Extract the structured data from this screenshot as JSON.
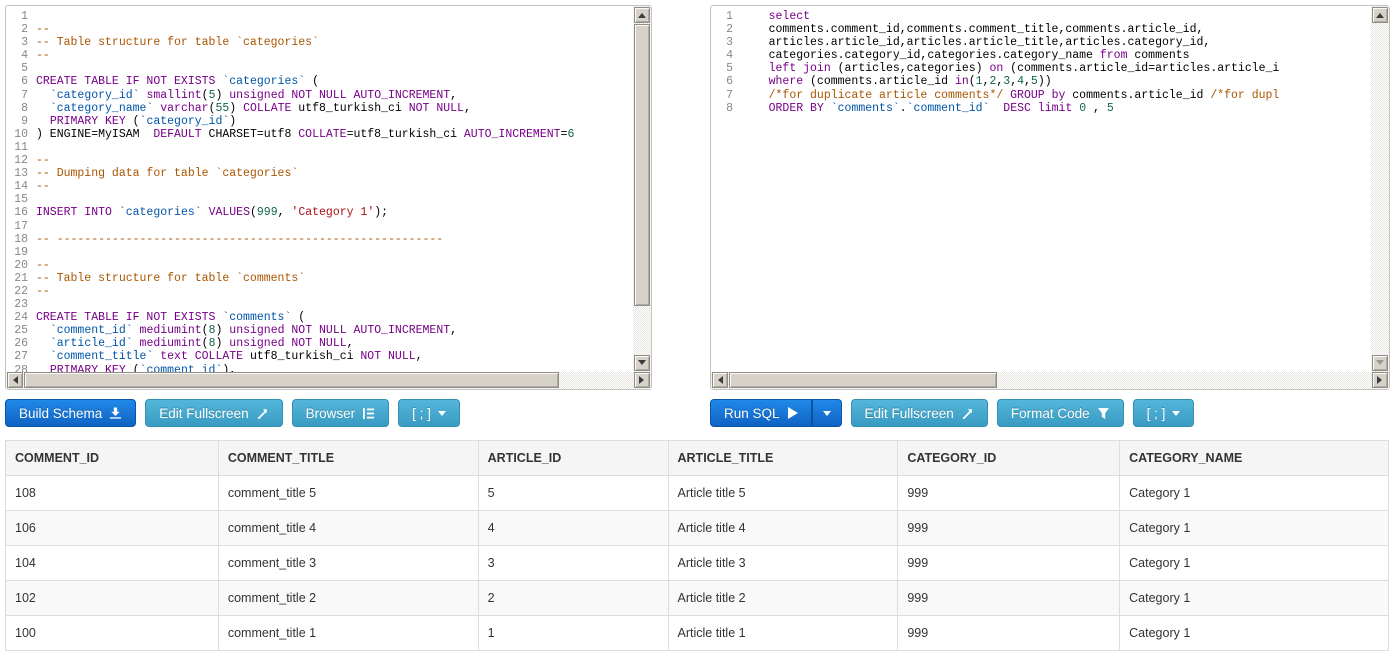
{
  "colors": {
    "keyword": "#770088",
    "comment": "#aa5500",
    "string": "#aa1111",
    "number": "#116644",
    "identifier": "#0055aa",
    "primary_button": "#0f63c3",
    "info_button": "#3a9bc2"
  },
  "icons": {
    "build_schema": "download-icon",
    "run_sql": "play-icon",
    "edit_fullscreen": "resize-full-icon",
    "browser": "indent-list-icon",
    "format_code": "funnel-icon",
    "terminator": "caret-down-icon"
  },
  "schema_panel": {
    "buttons": {
      "build_schema": "Build Schema",
      "edit_fullscreen": "Edit Fullscreen",
      "browser": "Browser",
      "terminator": "[ ; ]"
    },
    "lines": [
      [],
      [
        [
          "cm",
          "--"
        ]
      ],
      [
        [
          "cm",
          "-- Table structure for table `categories`"
        ]
      ],
      [
        [
          "cm",
          "--"
        ]
      ],
      [],
      [
        [
          "kw",
          "CREATE TABLE IF NOT EXISTS"
        ],
        [
          "p",
          " "
        ],
        [
          "id",
          "`categories`"
        ],
        [
          "p",
          " ("
        ]
      ],
      [
        [
          "p",
          "  "
        ],
        [
          "id",
          "`category_id`"
        ],
        [
          "p",
          " "
        ],
        [
          "kw",
          "smallint"
        ],
        [
          "p",
          "("
        ],
        [
          "num",
          "5"
        ],
        [
          "p",
          ") "
        ],
        [
          "kw",
          "unsigned NOT NULL AUTO_INCREMENT"
        ],
        [
          "p",
          ","
        ]
      ],
      [
        [
          "p",
          "  "
        ],
        [
          "id",
          "`category_name`"
        ],
        [
          "p",
          " "
        ],
        [
          "kw",
          "varchar"
        ],
        [
          "p",
          "("
        ],
        [
          "num",
          "55"
        ],
        [
          "p",
          ") "
        ],
        [
          "kw",
          "COLLATE"
        ],
        [
          "p",
          " utf8_turkish_ci "
        ],
        [
          "kw",
          "NOT NULL"
        ],
        [
          "p",
          ","
        ]
      ],
      [
        [
          "p",
          "  "
        ],
        [
          "kw",
          "PRIMARY KEY"
        ],
        [
          "p",
          " ("
        ],
        [
          "id",
          "`category_id`"
        ],
        [
          "p",
          ")"
        ]
      ],
      [
        [
          "p",
          ") ENGINE=MyISAM  "
        ],
        [
          "kw",
          "DEFAULT"
        ],
        [
          "p",
          " CHARSET=utf8 "
        ],
        [
          "kw",
          "COLLATE"
        ],
        [
          "p",
          "=utf8_turkish_ci "
        ],
        [
          "kw",
          "AUTO_INCREMENT"
        ],
        [
          "p",
          "="
        ],
        [
          "num",
          "6"
        ]
      ],
      [],
      [
        [
          "cm",
          "--"
        ]
      ],
      [
        [
          "cm",
          "-- Dumping data for table `categories`"
        ]
      ],
      [
        [
          "cm",
          "--"
        ]
      ],
      [],
      [
        [
          "kw",
          "INSERT INTO"
        ],
        [
          "p",
          " "
        ],
        [
          "id",
          "`categories`"
        ],
        [
          "p",
          " "
        ],
        [
          "kw",
          "VALUES"
        ],
        [
          "p",
          "("
        ],
        [
          "num",
          "999"
        ],
        [
          "p",
          ", "
        ],
        [
          "str",
          "'Category 1'"
        ],
        [
          "p",
          ");"
        ]
      ],
      [],
      [
        [
          "cm",
          "-- --------------------------------------------------------"
        ]
      ],
      [],
      [
        [
          "cm",
          "--"
        ]
      ],
      [
        [
          "cm",
          "-- Table structure for table `comments`"
        ]
      ],
      [
        [
          "cm",
          "--"
        ]
      ],
      [],
      [
        [
          "kw",
          "CREATE TABLE IF NOT EXISTS"
        ],
        [
          "p",
          " "
        ],
        [
          "id",
          "`comments`"
        ],
        [
          "p",
          " ("
        ]
      ],
      [
        [
          "p",
          "  "
        ],
        [
          "id",
          "`comment_id`"
        ],
        [
          "p",
          " "
        ],
        [
          "kw",
          "mediumint"
        ],
        [
          "p",
          "("
        ],
        [
          "num",
          "8"
        ],
        [
          "p",
          ") "
        ],
        [
          "kw",
          "unsigned NOT NULL AUTO_INCREMENT"
        ],
        [
          "p",
          ","
        ]
      ],
      [
        [
          "p",
          "  "
        ],
        [
          "id",
          "`article_id`"
        ],
        [
          "p",
          " "
        ],
        [
          "kw",
          "mediumint"
        ],
        [
          "p",
          "("
        ],
        [
          "num",
          "8"
        ],
        [
          "p",
          ") "
        ],
        [
          "kw",
          "unsigned NOT NULL"
        ],
        [
          "p",
          ","
        ]
      ],
      [
        [
          "p",
          "  "
        ],
        [
          "id",
          "`comment_title`"
        ],
        [
          "p",
          " "
        ],
        [
          "kw",
          "text COLLATE"
        ],
        [
          "p",
          " utf8_turkish_ci "
        ],
        [
          "kw",
          "NOT NULL"
        ],
        [
          "p",
          ","
        ]
      ],
      [
        [
          "p",
          "  "
        ],
        [
          "kw",
          "PRIMARY KEY"
        ],
        [
          "p",
          " ("
        ],
        [
          "id",
          "`comment_id`"
        ],
        [
          "p",
          "),"
        ]
      ]
    ]
  },
  "query_panel": {
    "buttons": {
      "run_sql": "Run SQL",
      "edit_fullscreen": "Edit Fullscreen",
      "format_code": "Format Code",
      "terminator": "[ ; ]"
    },
    "lines": [
      [
        [
          "p",
          "    "
        ],
        [
          "kw",
          "select"
        ]
      ],
      [
        [
          "p",
          "    comments.comment_id,comments.comment_title,comments.article_id,"
        ]
      ],
      [
        [
          "p",
          "    articles.article_id,articles.article_title,articles.category_id,"
        ]
      ],
      [
        [
          "p",
          "    categories.category_id,categories.category_name "
        ],
        [
          "kw",
          "from"
        ],
        [
          "p",
          " comments"
        ]
      ],
      [
        [
          "p",
          "    "
        ],
        [
          "kw",
          "left join"
        ],
        [
          "p",
          " (articles,categories) "
        ],
        [
          "kw",
          "on"
        ],
        [
          "p",
          " (comments.article_id=articles.article_i"
        ]
      ],
      [
        [
          "p",
          "    "
        ],
        [
          "kw",
          "where"
        ],
        [
          "p",
          " (comments.article_id "
        ],
        [
          "kw",
          "in"
        ],
        [
          "p",
          "("
        ],
        [
          "num",
          "1"
        ],
        [
          "p",
          ","
        ],
        [
          "num",
          "2"
        ],
        [
          "p",
          ","
        ],
        [
          "num",
          "3"
        ],
        [
          "p",
          ","
        ],
        [
          "num",
          "4"
        ],
        [
          "p",
          ","
        ],
        [
          "num",
          "5"
        ],
        [
          "p",
          "))"
        ]
      ],
      [
        [
          "p",
          "    "
        ],
        [
          "cm",
          "/*for duplicate article comments*/"
        ],
        [
          "p",
          " "
        ],
        [
          "kw",
          "GROUP by"
        ],
        [
          "p",
          " comments.article_id "
        ],
        [
          "cm",
          "/*for dupl"
        ]
      ],
      [
        [
          "p",
          "    "
        ],
        [
          "kw",
          "ORDER BY"
        ],
        [
          "p",
          " "
        ],
        [
          "id",
          "`comments`"
        ],
        [
          "p",
          "."
        ],
        [
          "id",
          "`comment_id`"
        ],
        [
          "p",
          "  "
        ],
        [
          "kw",
          "DESC limit"
        ],
        [
          "p",
          " "
        ],
        [
          "num",
          "0"
        ],
        [
          "p",
          " , "
        ],
        [
          "num",
          "5"
        ]
      ]
    ]
  },
  "result_table": {
    "columns": [
      "COMMENT_ID",
      "COMMENT_TITLE",
      "ARTICLE_ID",
      "ARTICLE_TITLE",
      "CATEGORY_ID",
      "CATEGORY_NAME"
    ],
    "rows": [
      [
        "108",
        "comment_title 5",
        "5",
        "Article title 5",
        "999",
        "Category 1"
      ],
      [
        "106",
        "comment_title 4",
        "4",
        "Article title 4",
        "999",
        "Category 1"
      ],
      [
        "104",
        "comment_title 3",
        "3",
        "Article title 3",
        "999",
        "Category 1"
      ],
      [
        "102",
        "comment_title 2",
        "2",
        "Article title 2",
        "999",
        "Category 1"
      ],
      [
        "100",
        "comment_title 1",
        "1",
        "Article title 1",
        "999",
        "Category 1"
      ]
    ]
  }
}
